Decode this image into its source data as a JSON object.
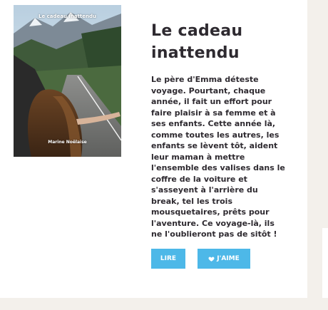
{
  "book": {
    "cover_title": "Le cadeau inattendu",
    "cover_author": "Marine Noëlaise",
    "title": "Le cadeau inattendu",
    "synopsis": "Le père d'Emma déteste voyage. Pourtant, chaque année, il fait un effort pour faire plaisir à sa femme et à ses enfants. Cette année là, comme toutes les autres, les enfants se lèvent tôt, aident leur maman à mettre l'ensemble des valises dans le coffre de la voiture et s'asseyent à l'arrière du break, tel les trois mousquetaires, prêts pour l'aventure. Ce voyage-là, ils ne l'oublieront pas de sitôt !"
  },
  "actions": {
    "read_label": "LIRE",
    "like_label": "J'AIME",
    "like_icon": "heart-icon"
  },
  "colors": {
    "accent": "#4db8e8",
    "text": "#2e2a30",
    "page_background": "#f3f0eb",
    "card_background": "#ffffff"
  }
}
